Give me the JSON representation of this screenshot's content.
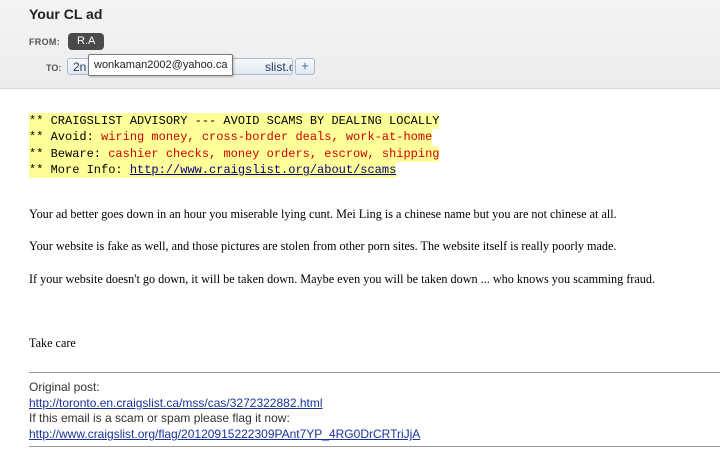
{
  "email": {
    "subject": "Your CL ad",
    "from_label": "FROM:",
    "from_name": "R.A",
    "to_label": "TO:",
    "to_pre": "2n",
    "to_post": "slist.org",
    "add_recipient": "+",
    "tooltip_email": "wonkaman2002@yahoo.ca"
  },
  "advisory": {
    "line1": "** CRAIGSLIST ADVISORY --- AVOID SCAMS BY DEALING LOCALLY",
    "line2_prefix": "** Avoid: ",
    "line2_red": "wiring money, cross-border deals, work-at-home",
    "line3_prefix": "** Beware: ",
    "line3_red": "cashier checks, money orders, escrow, shipping",
    "line4_prefix": "** More Info: ",
    "line4_link": "http://www.craigslist.org/about/scams"
  },
  "body": {
    "p1": "Your ad better goes down in an hour you miserable lying cunt.  Mei Ling is a chinese name but you are not chinese at all.",
    "p2": "Your website is fake as well, and those pictures are stolen from other porn sites.  The website itself is really poorly made.",
    "p3": "If your website doesn't go down, it will be taken down.  Maybe even you will be taken down ... who knows you scamming fraud.",
    "signoff": "Take care"
  },
  "footer": {
    "original_post_label": "Original post:",
    "original_post_link": "http://toronto.en.craigslist.ca/mss/cas/3272322882.html",
    "flag_label": "If this email is a scam or spam please flag it now:",
    "flag_link": "http://www.craigslist.org/flag/20120915222309PAnt7YP_4RG0DrCRTriJjA"
  },
  "colors": {
    "highlight": "#ffff99",
    "warning_red": "#cc0000",
    "link_blue": "#1a3399"
  }
}
